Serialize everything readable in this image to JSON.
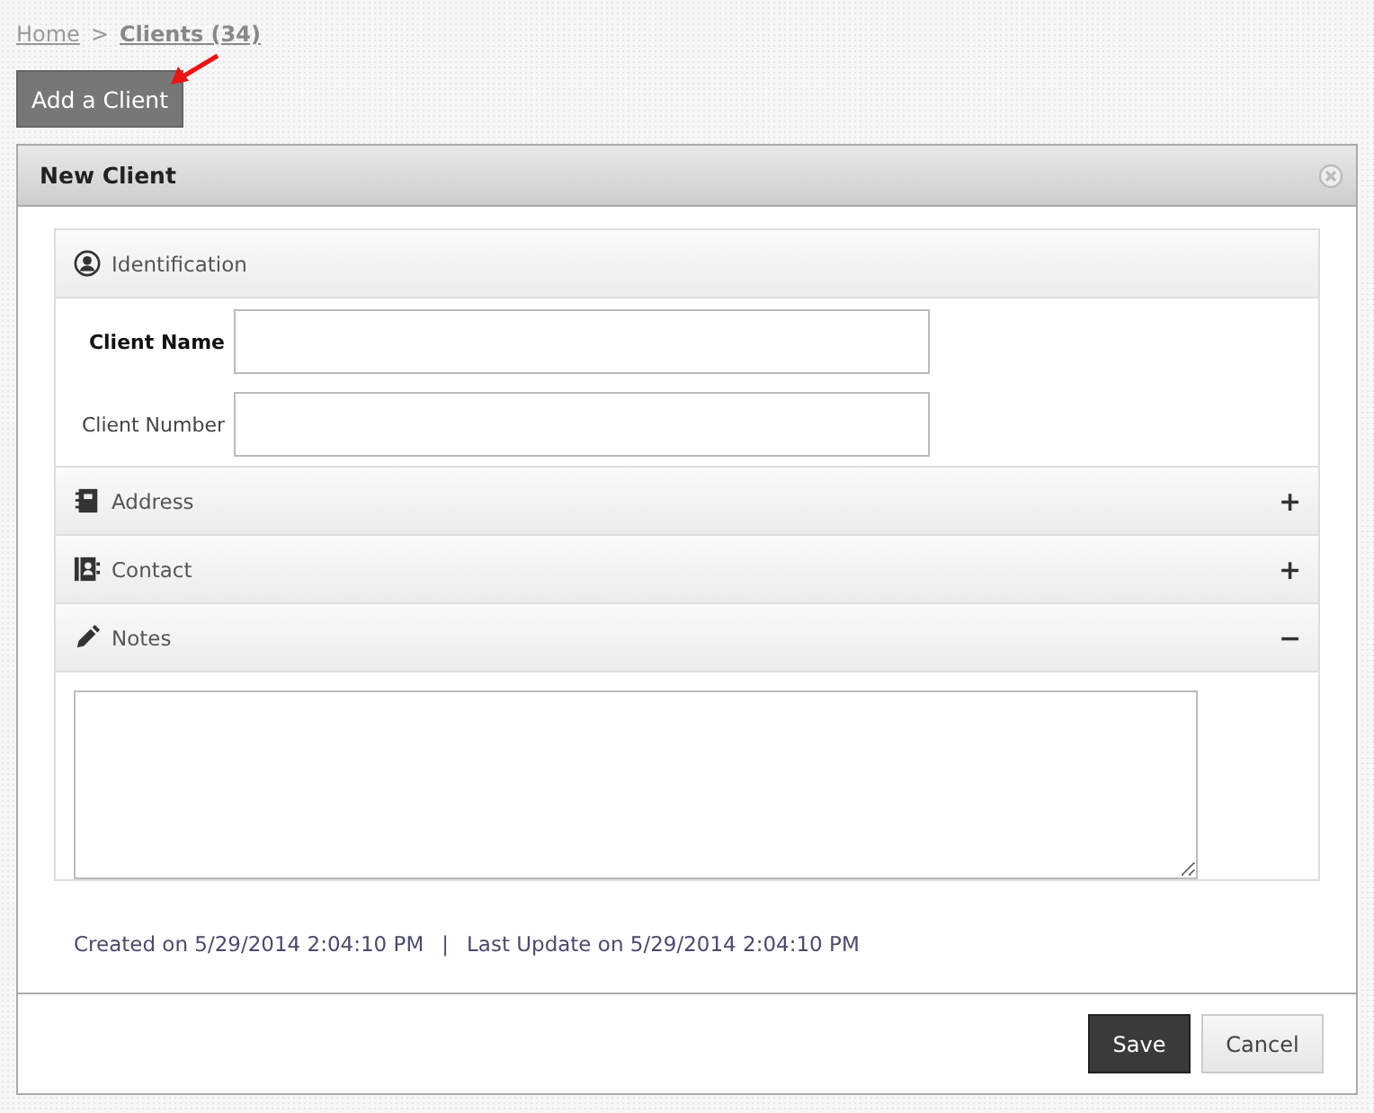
{
  "breadcrumb": [
    {
      "label": "Home",
      "current": false
    },
    {
      "label": "Clients (34)",
      "current": true
    }
  ],
  "breadcrumb_separator": ">",
  "add_button": "Add a Client",
  "dialog": {
    "title": "New Client",
    "sections": [
      {
        "kind": "identification",
        "title": "Identification",
        "fields": [
          {
            "label": "Client Name",
            "required": true
          },
          {
            "label": "Client Number",
            "required": false
          }
        ]
      },
      {
        "kind": "address",
        "title": "Address",
        "toggle": "+"
      },
      {
        "kind": "contact",
        "title": "Contact",
        "toggle": "+"
      },
      {
        "kind": "notes",
        "title": "Notes",
        "toggle": "−"
      }
    ],
    "created": "Created on 5/29/2014 2:04:10 PM",
    "separator": "|",
    "updated": "Last Update on 5/29/2014 2:04:10 PM",
    "buttons": [
      {
        "label": "Save",
        "kind": "primary"
      },
      {
        "label": "Cancel",
        "kind": "secondary"
      }
    ]
  }
}
